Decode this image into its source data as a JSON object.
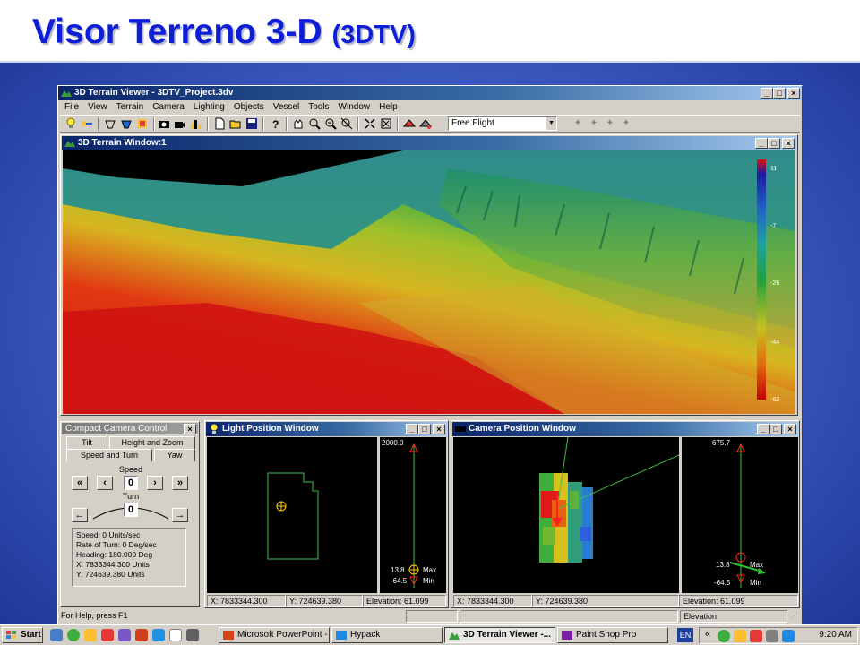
{
  "slide": {
    "title_main": "Visor Terreno 3-D ",
    "title_paren": "(3DTV)"
  },
  "app": {
    "title": "3D Terrain Viewer - 3DTV_Project.3dv",
    "menu": [
      "File",
      "View",
      "Terrain",
      "Camera",
      "Lighting",
      "Objects",
      "Vessel",
      "Tools",
      "Window",
      "Help"
    ],
    "mode_select": {
      "selected": "Free Flight"
    }
  },
  "terrain_window": {
    "title": "3D Terrain Window:1",
    "legend": {
      "labels": [
        "11",
        "-7",
        "-26",
        "-44",
        "-62"
      ]
    }
  },
  "camera_control": {
    "title": "Compact Camera Control",
    "tabs": [
      "Tilt",
      "Height and Zoom",
      "Speed and Turn",
      "Yaw"
    ],
    "speed_label": "Speed",
    "speed_value": "0",
    "turn_label": "Turn",
    "turn_value": "0",
    "info": [
      "Speed: 0 Units/sec",
      "Rate of Turn: 0 Deg/sec",
      "Heading: 180.000 Deg",
      "X: 7833344.300 Units",
      "Y: 724639.380 Units"
    ]
  },
  "light_window": {
    "title": "Light Position Window",
    "top_value": "2000.0",
    "current_value": "13.8",
    "max_label": "Max",
    "min_value": "-64.5",
    "min_label": "Min",
    "status_x": "X: 7833344.300",
    "status_y": "Y: 724639.380",
    "status_elev": "Elevation: 61.099"
  },
  "camera_window": {
    "title": "Camera Position Window",
    "top_value": "675.7",
    "current_value": "13.8",
    "max_label": "Max",
    "min_value": "-64.5",
    "min_label": "Min",
    "status_x": "X: 7833344.300",
    "status_y": "Y: 724639.380",
    "status_elev": "Elevation: 61.099"
  },
  "statusbar": {
    "help": "For Help, press F1",
    "right": "Elevation"
  },
  "taskbar": {
    "start": "Start",
    "tasks": [
      "Microsoft PowerPoint - [...",
      "Hypack",
      "3D Terrain Viewer -...",
      "Paint Shop Pro"
    ],
    "lang": "EN",
    "clock": "9:20 AM"
  },
  "colors": {
    "title": "#0d1ed8",
    "titlebar": "#0a246a",
    "panel": "#d4d0c8"
  }
}
